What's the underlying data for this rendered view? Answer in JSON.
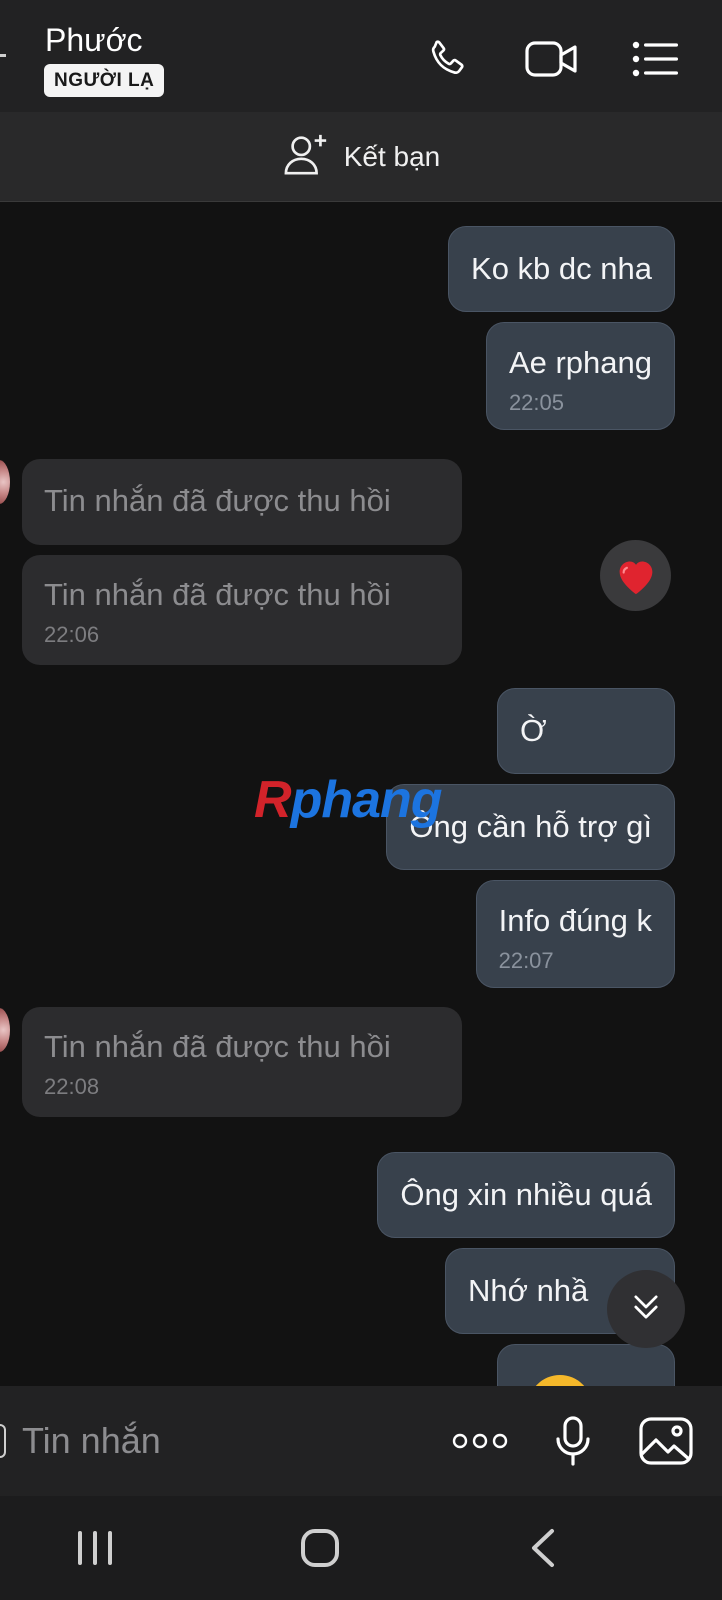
{
  "header": {
    "contact_name": "Phước",
    "badge": "NGƯỜI LẠ",
    "icons": [
      "phone-icon",
      "video-call-icon",
      "menu-list-icon"
    ]
  },
  "add_friend": {
    "label": "Kết bạn",
    "icon": "add-person-icon"
  },
  "messages": [
    {
      "direction": "out",
      "text": "Ko kb dc nha",
      "time": ""
    },
    {
      "direction": "out",
      "text": "Ae rphang",
      "time": "22:05"
    },
    {
      "direction": "in",
      "text": "Tin nhắn đã được thu hồi",
      "time": ""
    },
    {
      "direction": "in",
      "text": "Tin nhắn đã được thu hồi",
      "time": "22:06"
    },
    {
      "direction": "out",
      "text": "Ờ",
      "time": ""
    },
    {
      "direction": "out",
      "text": "Ông cần hỗ trợ gì",
      "time": ""
    },
    {
      "direction": "out",
      "text": "Info đúng k",
      "time": "22:07"
    },
    {
      "direction": "in",
      "text": "Tin nhắn đã được thu hồi",
      "time": "22:08"
    },
    {
      "direction": "out",
      "text": "Ông xin nhiều quá",
      "time": ""
    },
    {
      "direction": "out",
      "text": "Nhớ nhầ",
      "time": ""
    },
    {
      "direction": "out",
      "text": "",
      "time": ""
    }
  ],
  "reaction": {
    "emoji": "❤️",
    "icon": "heart-reaction-icon"
  },
  "watermark": {
    "first": "R",
    "rest": "phang"
  },
  "composer": {
    "placeholder": "Tin nhắn",
    "icons": [
      "more-options-icon",
      "microphone-icon",
      "image-gallery-icon"
    ]
  },
  "navbar": {
    "icons": [
      "recent-apps-icon",
      "home-icon",
      "back-icon"
    ]
  },
  "colors": {
    "outgoing_bubble": "#38414c",
    "incoming_bubble": "#2c2c2e",
    "background": "#121212",
    "watermark_red": "#d2232a",
    "watermark_blue": "#1c74e0"
  }
}
